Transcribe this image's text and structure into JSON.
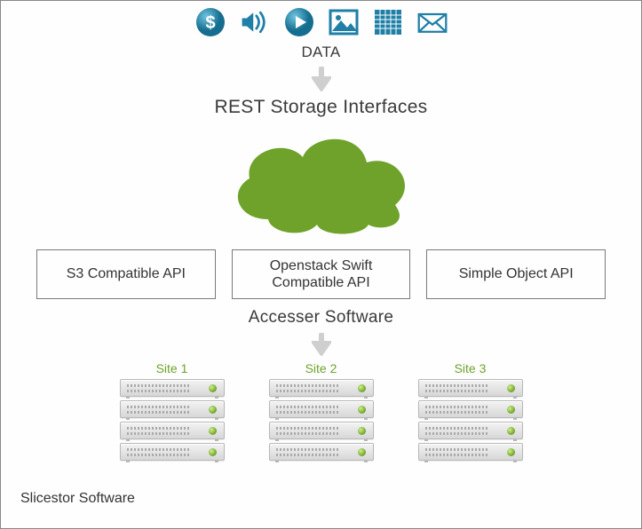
{
  "icons": [
    "dollar",
    "sound",
    "play",
    "image",
    "grid",
    "mail"
  ],
  "data_label": "DATA",
  "rest_label": "REST Storage Interfaces",
  "apis": [
    "S3 Compatible API",
    "Openstack Swift Compatible API",
    "Simple Object API"
  ],
  "accesser_label": "Accesser Software",
  "sites": [
    "Site 1",
    "Site 2",
    "Site 3"
  ],
  "racks_per_site": 4,
  "slicestor_label": "Slicestor Software",
  "colors": {
    "icon_teal": "#1f7fa6",
    "cloud_green": "#6ea22a",
    "arrow_grey": "#cfcfcf"
  }
}
